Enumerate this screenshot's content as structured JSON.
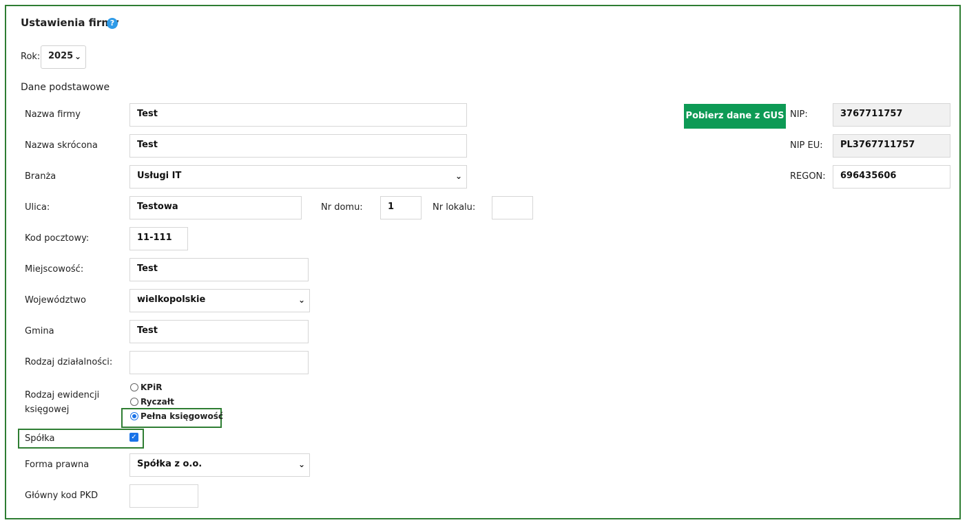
{
  "title": "Ustawienia firmy",
  "help_icon": "?",
  "year": {
    "label": "Rok:",
    "value": "2025"
  },
  "section_title": "Dane podstawowe",
  "gus_button": "Pobierz dane z GUS",
  "fields": {
    "nazwa_firmy": {
      "label": "Nazwa firmy",
      "value": "Test"
    },
    "nazwa_skrocona": {
      "label": "Nazwa skrócona",
      "value": "Test"
    },
    "branza": {
      "label": "Branża",
      "value": "Usługi IT"
    },
    "ulica": {
      "label": "Ulica:",
      "value": "Testowa"
    },
    "nr_domu": {
      "label": "Nr domu:",
      "value": "1"
    },
    "nr_lokalu": {
      "label": "Nr lokalu:",
      "value": ""
    },
    "kod_pocztowy": {
      "label": "Kod pocztowy:",
      "value": "11-111"
    },
    "miejscowosc": {
      "label": "Miejscowość:",
      "value": "Test"
    },
    "wojewodztwo": {
      "label": "Województwo",
      "value": "wielkopolskie"
    },
    "gmina": {
      "label": "Gmina",
      "value": "Test"
    },
    "rodzaj_dzialalnosci": {
      "label": "Rodzaj działalności:",
      "value": ""
    },
    "forma_prawna": {
      "label": "Forma prawna",
      "value": "Spółka z o.o."
    },
    "glowny_pkd": {
      "label": "Główny kod PKD",
      "value": ""
    },
    "nip": {
      "label": "NIP:",
      "value": "3767711757"
    },
    "nip_eu": {
      "label": "NIP EU:",
      "value": "PL3767711757"
    },
    "regon": {
      "label": "REGON:",
      "value": "696435606"
    }
  },
  "ewidencja": {
    "label_line1": "Rodzaj ewidencji",
    "label_line2": "księgowej",
    "options": [
      "KPiR",
      "Ryczałt",
      "Pełna księgowość"
    ],
    "selected": "Pełna księgowość"
  },
  "spolka": {
    "label": "Spółka",
    "checked": true,
    "check_glyph": "✓"
  },
  "colors": {
    "frame": "#2e7d32",
    "button": "#0d9a55",
    "accent": "#1a73e8"
  }
}
